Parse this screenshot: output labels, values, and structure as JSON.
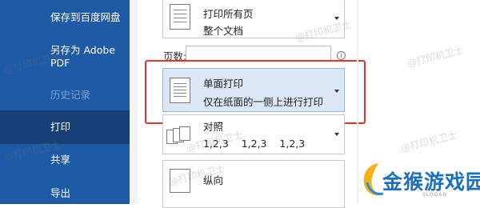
{
  "sidebar": {
    "items": [
      {
        "label": "保存到百度网盘"
      },
      {
        "label": "另存为 Adobe PDF"
      },
      {
        "label": "历史记录"
      },
      {
        "label": "打印"
      },
      {
        "label": "共享"
      },
      {
        "label": "导出"
      }
    ]
  },
  "print": {
    "pages_dropdown": {
      "title": "打印所有页",
      "subtitle": "整个文档"
    },
    "pages_label": "页数:",
    "pages_value": "",
    "sides_dropdown": {
      "title": "单面打印",
      "subtitle": "仅在纸面的一侧上进行打印"
    },
    "collate_dropdown": {
      "title": "对照",
      "subtitle": "1,2,3    1,2,3    1,2,3"
    },
    "orientation_dropdown": {
      "title": "纵向"
    }
  },
  "watermark": "@打印机卫士",
  "logo": {
    "text": "金猴游戏园",
    "slogan": "SLOGAN"
  },
  "colors": {
    "sidebar_bg": "#1f5aa6",
    "sidebar_active": "#173f78",
    "highlight_border": "#e5342c",
    "selected_bg": "#dbe6f7"
  }
}
